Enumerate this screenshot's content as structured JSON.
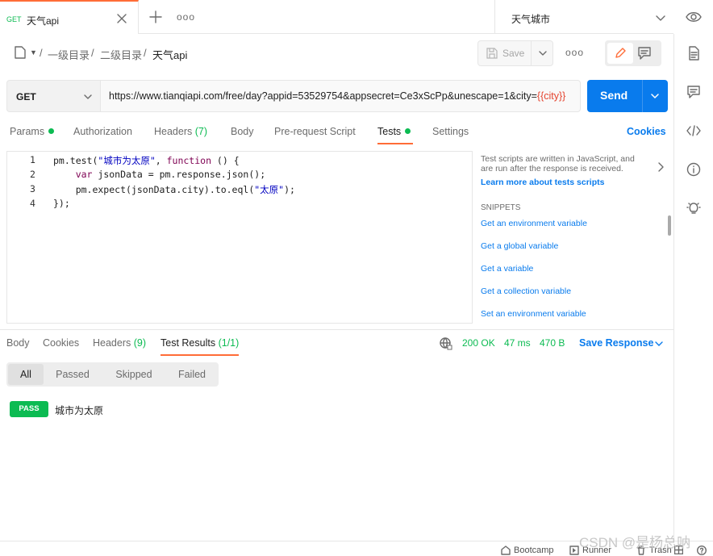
{
  "tab": {
    "method": "GET",
    "title": "天气api"
  },
  "environment": {
    "name": "天气城市"
  },
  "breadcrumb": {
    "level1": "一级目录",
    "level2": "二级目录",
    "current": "天气api",
    "sep": "/"
  },
  "toolbar": {
    "save_label": "Save",
    "more_label": "ooo"
  },
  "tabbar": {
    "more_label": "ooo"
  },
  "request": {
    "method": "GET",
    "url": "https://www.tianqiapi.com/free/day?appid=53529754&appsecret=Ce3xScPp&unescape=1&city=",
    "url_variable": "{{city}}",
    "send_label": "Send"
  },
  "request_tabs": {
    "params": "Params",
    "authorization": "Authorization",
    "headers": "Headers",
    "headers_count": "(7)",
    "body": "Body",
    "prerequest": "Pre-request Script",
    "tests": "Tests",
    "settings": "Settings",
    "cookies": "Cookies"
  },
  "editor": {
    "line_numbers": [
      "1",
      "2",
      "3",
      "4"
    ],
    "lines": [
      {
        "a": "pm.test(",
        "b": "\"城市为太原\"",
        "c": ", ",
        "d": "function",
        "e": " () {"
      },
      {
        "a": "    ",
        "b": "var",
        "c": " jsonData = pm.response.json();"
      },
      {
        "a": "    pm.expect(jsonData.city).to.eql(",
        "b": "\"太原\"",
        "c": ");"
      },
      {
        "a": "});"
      }
    ]
  },
  "snippets": {
    "description": "Test scripts are written in JavaScript, and are run after the response is received.",
    "learn_more": "Learn more about tests scripts",
    "heading": "SNIPPETS",
    "items": [
      "Get an environment variable",
      "Get a global variable",
      "Get a variable",
      "Get a collection variable",
      "Set an environment variable"
    ]
  },
  "response_tabs": {
    "body": "Body",
    "cookies": "Cookies",
    "headers": "Headers",
    "headers_count": "(9)",
    "test_results": "Test Results",
    "test_results_count": "(1/1)"
  },
  "response_status": {
    "status": "200 OK",
    "time": "47 ms",
    "size": "470 B",
    "save_response": "Save Response"
  },
  "filters": [
    "All",
    "Passed",
    "Skipped",
    "Failed"
  ],
  "test_result": {
    "badge": "PASS",
    "name": "城市为太原"
  },
  "footer": {
    "bootcamp": "Bootcamp",
    "runner": "Runner",
    "trash": "Trash"
  },
  "watermark": "CSDN @是杨总呐",
  "colors": {
    "accent": "#ff6c37",
    "primary": "#097bed",
    "success": "#0cbb52",
    "variable": "#e4442f"
  }
}
